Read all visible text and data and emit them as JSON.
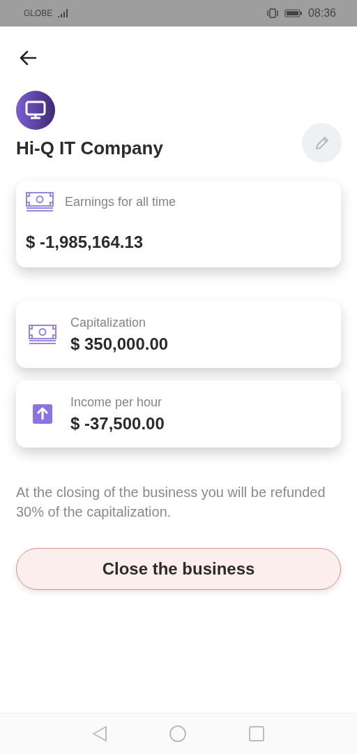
{
  "status_bar": {
    "carrier": "GLOBE",
    "time": "08:36"
  },
  "company": {
    "name": "Hi-Q IT Company"
  },
  "earnings": {
    "label": "Earnings for all time",
    "value": "$ -1,985,164.13"
  },
  "stats": [
    {
      "kind": "money",
      "label": "Capitalization",
      "value": "$ 350,000.00"
    },
    {
      "kind": "arrow-up",
      "label": "Income per hour",
      "value": "$ -37,500.00"
    }
  ],
  "note": "At the closing of the business you will be refunded 30% of the capitalization.",
  "close_button": "Close the business"
}
